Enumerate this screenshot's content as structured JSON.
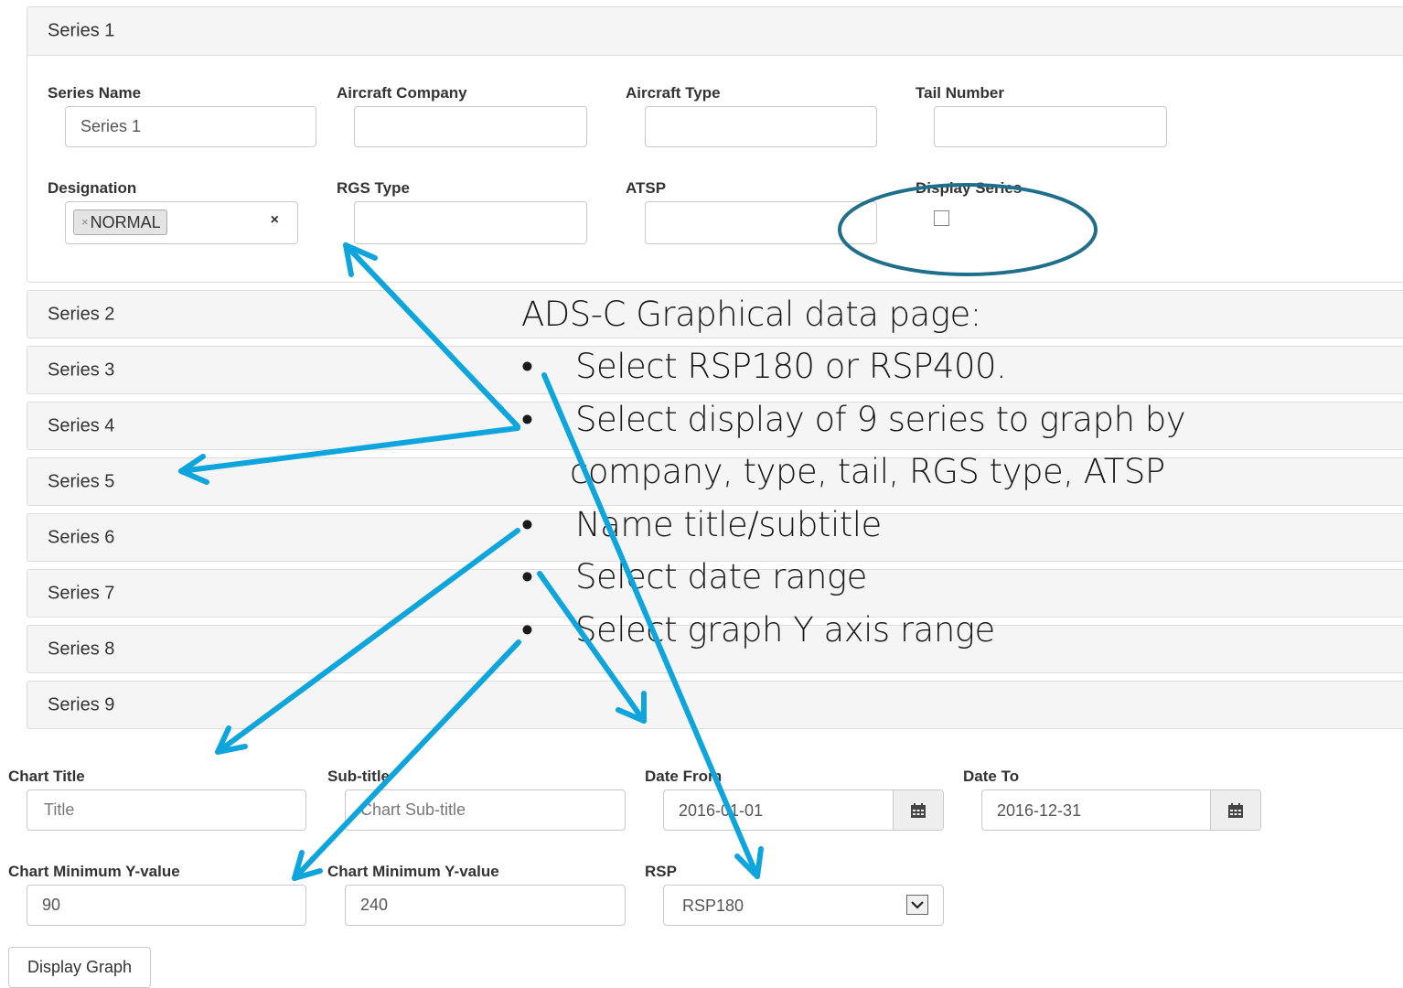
{
  "series1": {
    "title": "Series 1",
    "fields": {
      "series_name": {
        "label": "Series Name",
        "value": "Series 1"
      },
      "aircraft_company": {
        "label": "Aircraft Company",
        "value": ""
      },
      "aircraft_type": {
        "label": "Aircraft Type",
        "value": ""
      },
      "tail_number": {
        "label": "Tail Number",
        "value": ""
      },
      "designation": {
        "label": "Designation",
        "tag": "NORMAL",
        "tag_remove": "×",
        "clear": "×"
      },
      "rgs_type": {
        "label": "RGS Type",
        "value": ""
      },
      "atsp": {
        "label": "ATSP",
        "value": ""
      },
      "display_series": {
        "label": "Display Series",
        "checked": false
      }
    }
  },
  "series_collapsed": [
    "Series 2",
    "Series 3",
    "Series 4",
    "Series 5",
    "Series 6",
    "Series 7",
    "Series 8",
    "Series 9"
  ],
  "chart_settings": {
    "chart_title": {
      "label": "Chart Title",
      "placeholder": "Title"
    },
    "subtitle": {
      "label": "Sub-title",
      "placeholder": "Chart Sub-title"
    },
    "date_from": {
      "label": "Date From",
      "value": "2016-01-01"
    },
    "date_to": {
      "label": "Date To",
      "value": "2016-12-31"
    },
    "min_y": {
      "label": "Chart Minimum Y-value",
      "value": "90"
    },
    "max_y": {
      "label": "Chart Minimum Y-value",
      "value": "240"
    },
    "rsp": {
      "label": "RSP",
      "value": "RSP180"
    },
    "display_button": "Display Graph"
  },
  "annotation": {
    "heading": "ADS-C Graphical data page:",
    "bullets": [
      "Select RSP180 or RSP400.",
      "Select display of 9 series to graph by",
      "Name title/subtitle",
      "Select date range",
      "Select  graph Y  axis range"
    ],
    "continuation": "company, type, tail, RGS type, ATSP",
    "bullet_char": "•"
  },
  "colors": {
    "arrow": "#0ea5dc",
    "ellipse": "#1f6f8b"
  },
  "icons": {
    "calendar": "calendar-icon",
    "dropdown": "chevron-down-icon"
  }
}
